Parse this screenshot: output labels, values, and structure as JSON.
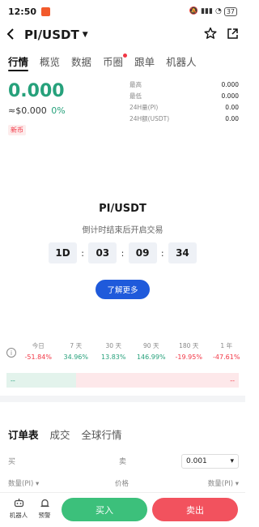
{
  "status": {
    "time": "12:50",
    "battery": "37"
  },
  "header": {
    "title": "PI/USDT"
  },
  "tabs": [
    {
      "label": "行情",
      "active": true
    },
    {
      "label": "概览"
    },
    {
      "label": "数据"
    },
    {
      "label": "币圈"
    },
    {
      "label": "跟单"
    },
    {
      "label": "机器人"
    }
  ],
  "price": {
    "last": "0.000",
    "fiat": "≈$0.000",
    "change_pct": "0%",
    "badge": "新币"
  },
  "stats": [
    {
      "label": "最高",
      "value": "0.000"
    },
    {
      "label": "最低",
      "value": "0.000"
    },
    {
      "label": "24H量(PI)",
      "value": "0.00"
    },
    {
      "label": "24H额(USDT)",
      "value": "0.00"
    }
  ],
  "countdown": {
    "title": "PI/USDT",
    "subtitle": "倒计时结束后开启交易",
    "days": "1D",
    "hours": "03",
    "minutes": "09",
    "seconds": "34",
    "separator": ":",
    "learn_more": "了解更多"
  },
  "performance": [
    {
      "label": "今日",
      "value": "-51.84%",
      "dir": "down"
    },
    {
      "label": "7 天",
      "value": "34.96%",
      "dir": "up"
    },
    {
      "label": "30 天",
      "value": "13.83%",
      "dir": "up"
    },
    {
      "label": "90 天",
      "value": "146.99%",
      "dir": "up"
    },
    {
      "label": "180 天",
      "value": "-19.95%",
      "dir": "down"
    },
    {
      "label": "1 年",
      "value": "-47.61%",
      "dir": "down"
    }
  ],
  "ratio": {
    "buy": "--",
    "sell": "--"
  },
  "book_tabs": [
    {
      "label": "订单表",
      "active": true
    },
    {
      "label": "成交"
    },
    {
      "label": "全球行情"
    }
  ],
  "book": {
    "buy_label": "买",
    "sell_label": "卖",
    "precision": "0.001",
    "col_amount_left": "数量(PI)",
    "col_price": "价格",
    "col_amount_right": "数量(PI)"
  },
  "bottom": {
    "robot": "机器人",
    "alert": "预警",
    "buy": "买入",
    "sell": "卖出"
  },
  "colors": {
    "up": "#26a17b",
    "down": "#f23645",
    "accent": "#1f5adb"
  }
}
